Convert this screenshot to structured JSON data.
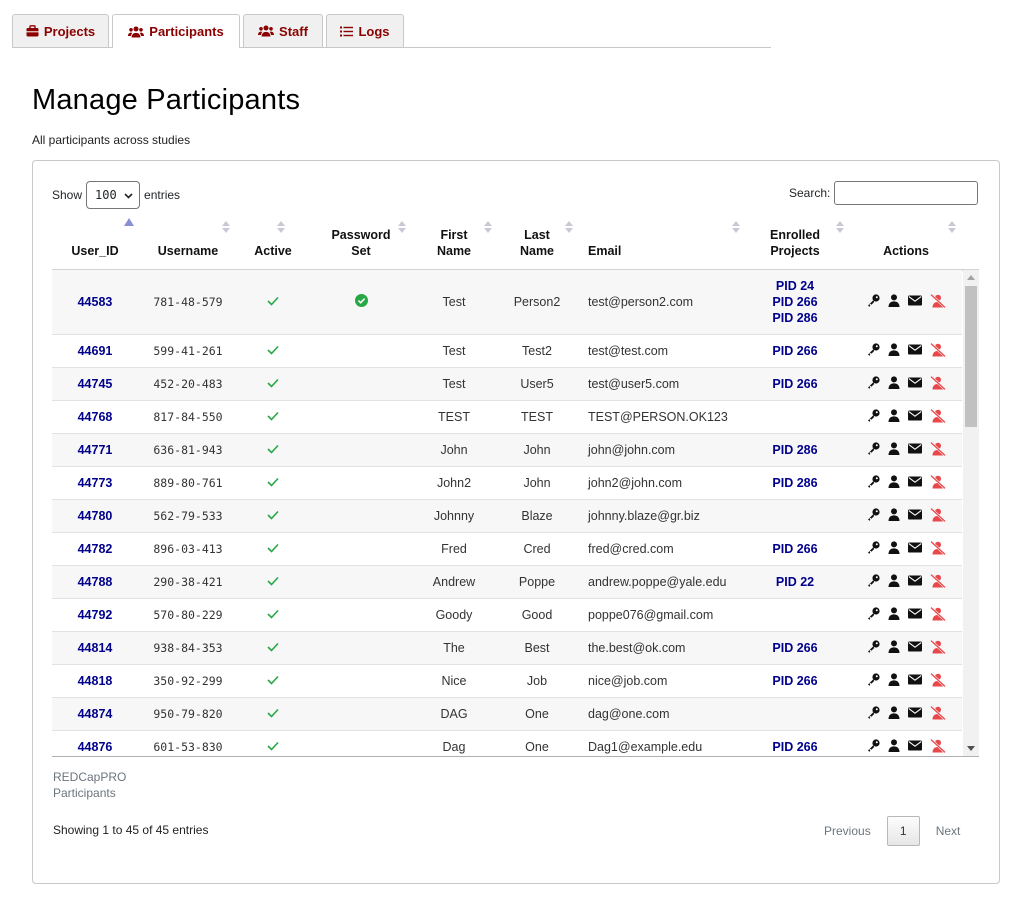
{
  "tabs": [
    {
      "label": "Projects",
      "icon": "briefcase-icon",
      "active": false
    },
    {
      "label": "Participants",
      "icon": "users-icon",
      "active": true
    },
    {
      "label": "Staff",
      "icon": "users-icon",
      "active": false
    },
    {
      "label": "Logs",
      "icon": "list-icon",
      "active": false
    }
  ],
  "page": {
    "title": "Manage Participants",
    "subtitle": "All participants across studies"
  },
  "table_controls": {
    "show_label": "Show",
    "page_length": "100",
    "entries_label": "entries",
    "search_label": "Search:",
    "search_value": ""
  },
  "columns": [
    {
      "key": "user_id",
      "lines": [
        "User_ID"
      ],
      "sorted": "asc"
    },
    {
      "key": "username",
      "lines": [
        "Username"
      ]
    },
    {
      "key": "active",
      "lines": [
        "Active"
      ]
    },
    {
      "key": "password_set",
      "lines": [
        "Password",
        "Set"
      ]
    },
    {
      "key": "first_name",
      "lines": [
        "First",
        "Name"
      ]
    },
    {
      "key": "last_name",
      "lines": [
        "Last",
        "Name"
      ]
    },
    {
      "key": "email",
      "lines": [
        "Email"
      ]
    },
    {
      "key": "enrolled_projects",
      "lines": [
        "Enrolled",
        "Projects"
      ]
    },
    {
      "key": "actions",
      "lines": [
        "Actions"
      ]
    }
  ],
  "rows": [
    {
      "user_id": "44583",
      "username": "781-48-579",
      "active": true,
      "password_set": true,
      "first": "Test",
      "last": "Person2",
      "email": "test@person2.com",
      "projects": [
        "PID 24",
        "PID 266",
        "PID 286"
      ]
    },
    {
      "user_id": "44691",
      "username": "599-41-261",
      "active": true,
      "password_set": false,
      "first": "Test",
      "last": "Test2",
      "email": "test@test.com",
      "projects": [
        "PID 266"
      ]
    },
    {
      "user_id": "44745",
      "username": "452-20-483",
      "active": true,
      "password_set": false,
      "first": "Test",
      "last": "User5",
      "email": "test@user5.com",
      "projects": [
        "PID 266"
      ]
    },
    {
      "user_id": "44768",
      "username": "817-84-550",
      "active": true,
      "password_set": false,
      "first": "TEST",
      "last": "TEST",
      "email": "TEST@PERSON.OK123",
      "projects": []
    },
    {
      "user_id": "44771",
      "username": "636-81-943",
      "active": true,
      "password_set": false,
      "first": "John",
      "last": "John",
      "email": "john@john.com",
      "projects": [
        "PID 286"
      ]
    },
    {
      "user_id": "44773",
      "username": "889-80-761",
      "active": true,
      "password_set": false,
      "first": "John2",
      "last": "John",
      "email": "john2@john.com",
      "projects": [
        "PID 286"
      ]
    },
    {
      "user_id": "44780",
      "username": "562-79-533",
      "active": true,
      "password_set": false,
      "first": "Johnny",
      "last": "Blaze",
      "email": "johnny.blaze@gr.biz",
      "projects": []
    },
    {
      "user_id": "44782",
      "username": "896-03-413",
      "active": true,
      "password_set": false,
      "first": "Fred",
      "last": "Cred",
      "email": "fred@cred.com",
      "projects": [
        "PID 266"
      ]
    },
    {
      "user_id": "44788",
      "username": "290-38-421",
      "active": true,
      "password_set": false,
      "first": "Andrew",
      "last": "Poppe",
      "email": "andrew.poppe@yale.edu",
      "projects": [
        "PID 22"
      ]
    },
    {
      "user_id": "44792",
      "username": "570-80-229",
      "active": true,
      "password_set": false,
      "first": "Goody",
      "last": "Good",
      "email": "poppe076@gmail.com",
      "projects": []
    },
    {
      "user_id": "44814",
      "username": "938-84-353",
      "active": true,
      "password_set": false,
      "first": "The",
      "last": "Best",
      "email": "the.best@ok.com",
      "projects": [
        "PID 266"
      ]
    },
    {
      "user_id": "44818",
      "username": "350-92-299",
      "active": true,
      "password_set": false,
      "first": "Nice",
      "last": "Job",
      "email": "nice@job.com",
      "projects": [
        "PID 266"
      ]
    },
    {
      "user_id": "44874",
      "username": "950-79-820",
      "active": true,
      "password_set": false,
      "first": "DAG",
      "last": "One",
      "email": "dag@one.com",
      "projects": []
    },
    {
      "user_id": "44876",
      "username": "601-53-830",
      "active": true,
      "password_set": false,
      "first": "Dag",
      "last": "One",
      "email": "Dag1@example.edu",
      "projects": [
        "PID 266"
      ]
    }
  ],
  "row_actions": [
    "key-icon",
    "user-icon",
    "envelope-icon",
    "user-slash-icon"
  ],
  "caption": {
    "line1": "REDCapPRO",
    "line2": "Participants"
  },
  "info": "Showing 1 to 45 of 45 entries",
  "pagination": {
    "previous": "Previous",
    "current": "1",
    "next": "Next"
  },
  "colors": {
    "tab_text": "#8b0000",
    "link": "#00008b",
    "check": "#28a745",
    "revoke": "#e8484b"
  }
}
